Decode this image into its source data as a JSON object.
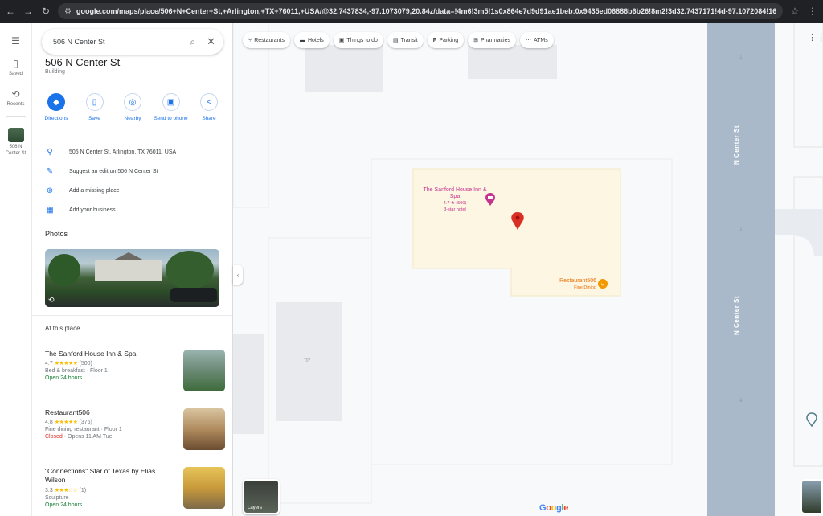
{
  "browser": {
    "url": "google.com/maps/place/506+N+Center+St,+Arlington,+TX+76011,+USA/@32.7437834,-97.1073079,20.84z/data=!4m6!3m5!1s0x864e7d9d91ae1beb:0x9435ed06886b6b26!8m2!3d32.7437171!4d-97.1072084!16s%2..."
  },
  "rail": {
    "items": [
      {
        "icon": "menu-icon",
        "label": ""
      },
      {
        "icon": "bookmark-icon",
        "label": "Saved"
      },
      {
        "icon": "history-icon",
        "label": "Recents"
      },
      {
        "icon": "recent-thumb",
        "label": "506 N Center St"
      }
    ]
  },
  "search": {
    "query": "506 N Center St"
  },
  "place": {
    "title": "506 N Center St",
    "subtitle": "Building",
    "actions": [
      {
        "label": "Directions",
        "icon": "directions-icon"
      },
      {
        "label": "Save",
        "icon": "bookmark-icon"
      },
      {
        "label": "Nearby",
        "icon": "nearby-icon"
      },
      {
        "label": "Send to phone",
        "icon": "phone-icon"
      },
      {
        "label": "Share",
        "icon": "share-icon"
      }
    ],
    "info": [
      {
        "icon": "location-pin-icon",
        "text": "506 N Center St, Arlington, TX 76011, USA"
      },
      {
        "icon": "edit-pencil-icon",
        "text": "Suggest an edit on 506 N Center St"
      },
      {
        "icon": "add-place-icon",
        "text": "Add a missing place"
      },
      {
        "icon": "storefront-icon",
        "text": "Add your business"
      }
    ],
    "photos_heading": "Photos",
    "at_this_place_heading": "At this place",
    "places": [
      {
        "name": "The Sanford House Inn & Spa",
        "rating": "4.7",
        "stars": "★★★★★",
        "reviews": "(500)",
        "type": "Bed & breakfast · Floor 1",
        "status": "Open 24 hours",
        "status_kind": "open",
        "hours": ""
      },
      {
        "name": "Restaurant506",
        "rating": "4.8",
        "stars": "★★★★★",
        "reviews": "(376)",
        "type": "Fine dining restaurant · Floor 1",
        "status": "Closed",
        "status_kind": "closed",
        "hours": " · Opens 11 AM Tue"
      },
      {
        "name": "\"Connections\" Star of Texas by Elias Wilson",
        "rating": "3.3",
        "stars": "★★★☆☆",
        "reviews": "(1)",
        "type": "Sculpture",
        "status": "Open 24 hours",
        "status_kind": "open",
        "hours": ""
      }
    ]
  },
  "map": {
    "chips": [
      {
        "icon": "fork-icon",
        "label": "Restaurants"
      },
      {
        "icon": "bed-icon",
        "label": "Hotels"
      },
      {
        "icon": "camera-icon",
        "label": "Things to do"
      },
      {
        "icon": "bus-icon",
        "label": "Transit"
      },
      {
        "icon": "parking-icon",
        "label": "Parking"
      },
      {
        "icon": "pharmacy-icon",
        "label": "Pharmacies"
      },
      {
        "icon": "atm-icon",
        "label": "ATMs"
      }
    ],
    "streets": [
      "N Center St",
      "N Center St"
    ],
    "poi_sanford": {
      "name": "The Sanford House Inn & Spa",
      "rating": "4.7 ★ (500)",
      "type": "3-star hotel"
    },
    "poi_restaurant": {
      "name": "Restaurant506",
      "type": "Fine Dining"
    },
    "building_number": "707",
    "layers_label": "Layers",
    "google_logo": "Google",
    "colors": {
      "accent": "#1a73e8",
      "pin": "#d93025",
      "hotel": "#c5338e",
      "restaurant": "#e8710a",
      "road": "#aab9c9",
      "parcel": "#fdf6e3"
    }
  }
}
